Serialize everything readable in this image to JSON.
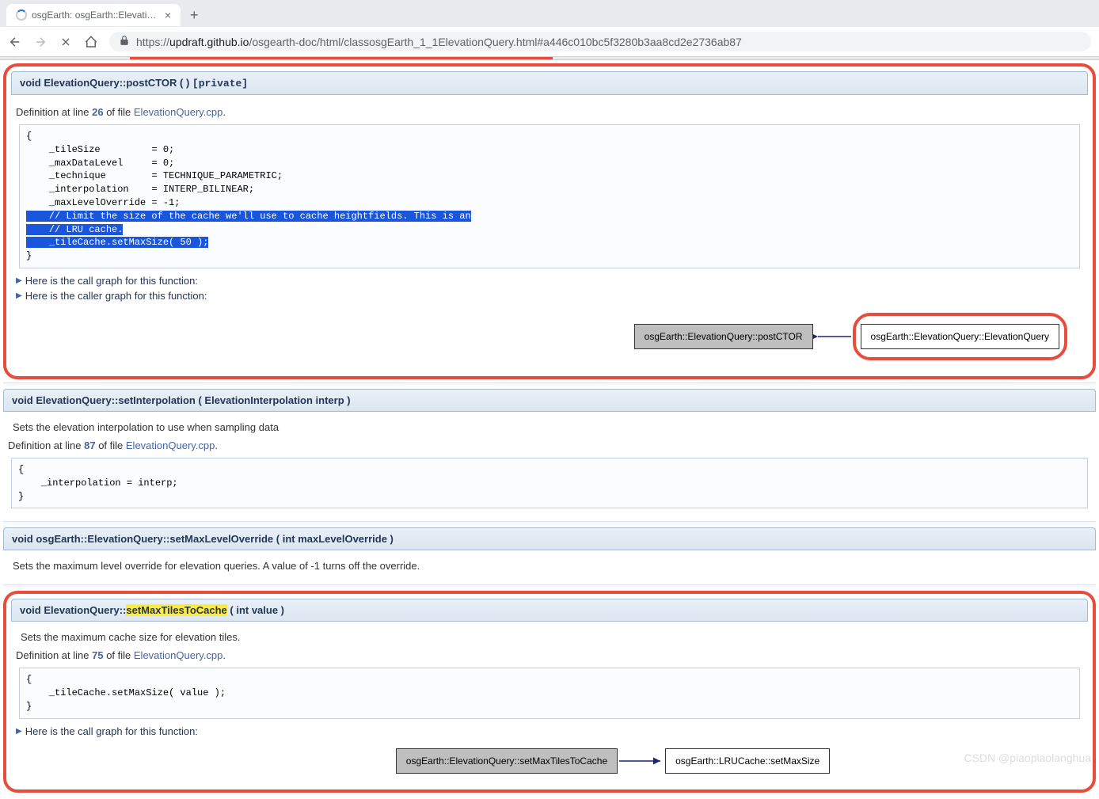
{
  "browser": {
    "tab_title": "osgEarth: osgEarth::ElevationQ",
    "url_display_prefix": "https://",
    "url_host": "updraft.github.io",
    "url_path": "/osgearth-doc/html/classosgEarth_1_1ElevationQuery.html#a446c010bc5f3280b3aa8cd2e2736ab87"
  },
  "func1": {
    "sig_pre": "void ElevationQuery::postCTOR (  ) ",
    "private": "[private]",
    "def_prefix": "Definition at line ",
    "def_line": "26",
    "def_mid": " of file ",
    "def_file": "ElevationQuery.cpp",
    "def_dot": ".",
    "code_plain": "{\n    _tileSize         = 0;\n    _maxDataLevel     = 0;\n    _technique        = TECHNIQUE_PARAMETRIC;\n    _interpolation    = INTERP_BILINEAR;\n    _maxLevelOverride = -1;\n",
    "code_sel": "    // Limit the size of the cache we'll use to cache heightfields. This is an\n    // LRU cache.\n    _tileCache.setMaxSize( 50 );",
    "code_close": "\n}",
    "expand_call": "Here is the call graph for this function:",
    "expand_caller": "Here is the caller graph for this function:",
    "graph_left": "osgEarth::ElevationQuery::postCTOR",
    "graph_right": "osgEarth::ElevationQuery::ElevationQuery"
  },
  "func2": {
    "sig": "void ElevationQuery::setInterpolation ( ElevationInterpolation  interp )",
    "desc": "Sets the elevation interpolation to use when sampling data",
    "def_prefix": "Definition at line ",
    "def_line": "87",
    "def_mid": " of file ",
    "def_file": "ElevationQuery.cpp",
    "def_dot": ".",
    "code": "{\n    _interpolation = interp;\n}"
  },
  "func3": {
    "sig": "void osgEarth::ElevationQuery::setMaxLevelOverride ( int  maxLevelOverride )",
    "desc": "Sets the maximum level override for elevation queries. A value of -1 turns off the override."
  },
  "func4": {
    "sig_pre": "void ElevationQuery::",
    "sig_hl": "setMaxTilesToCache",
    "sig_post": " ( int  value )",
    "desc": "Sets the maximum cache size for elevation tiles.",
    "def_prefix": "Definition at line ",
    "def_line": "75",
    "def_mid": " of file ",
    "def_file": "ElevationQuery.cpp",
    "def_dot": ".",
    "code": "{\n    _tileCache.setMaxSize( value );\n}",
    "expand_call": "Here is the call graph for this function:",
    "graph_left": "osgEarth::ElevationQuery::setMaxTilesToCache",
    "graph_right": "osgEarth::LRUCache::setMaxSize"
  },
  "watermark": "CSDN @piaopiaolanghua"
}
